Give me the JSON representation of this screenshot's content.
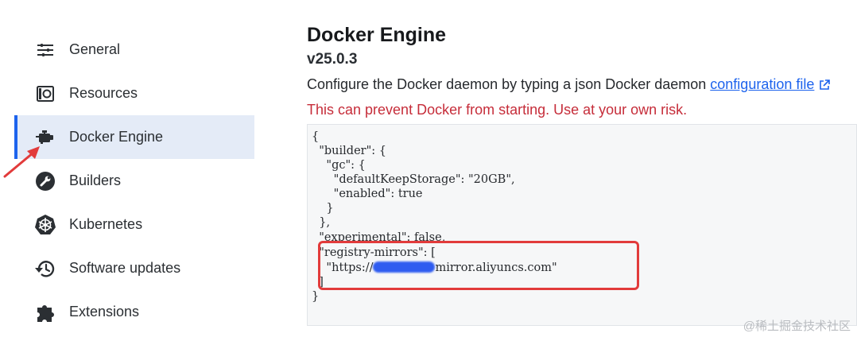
{
  "sidebar": {
    "items": [
      {
        "label": "General",
        "icon": "sliders-icon"
      },
      {
        "label": "Resources",
        "icon": "resources-icon"
      },
      {
        "label": "Docker Engine",
        "icon": "engine-icon",
        "active": true
      },
      {
        "label": "Builders",
        "icon": "wrench-icon"
      },
      {
        "label": "Kubernetes",
        "icon": "kubernetes-icon"
      },
      {
        "label": "Software updates",
        "icon": "history-icon"
      },
      {
        "label": "Extensions",
        "icon": "puzzle-icon"
      }
    ]
  },
  "main": {
    "title": "Docker Engine",
    "version": "v25.0.3",
    "description_prefix": "Configure the Docker daemon by typing a json Docker daemon ",
    "description_link": "configuration file",
    "warning": "This can prevent Docker from starting. Use at your own risk."
  },
  "editor": {
    "lines": [
      "{",
      "  \"builder\": {",
      "    \"gc\": {",
      "      \"defaultKeepStorage\": \"20GB\",",
      "      \"enabled\": true",
      "    }",
      "  },",
      "  \"experimental\": false,",
      "  \"registry-mirrors\": [",
      "    \"https://",
      "  ]",
      "}"
    ],
    "mirror_suffix": "mirror.aliyuncs.com\""
  },
  "watermark": "@稀土掘金技术社区",
  "colors": {
    "accent": "#1d63ed",
    "active_bg": "#e4ebf7",
    "warning": "#c62d3a",
    "annotation": "#e23b3b"
  }
}
